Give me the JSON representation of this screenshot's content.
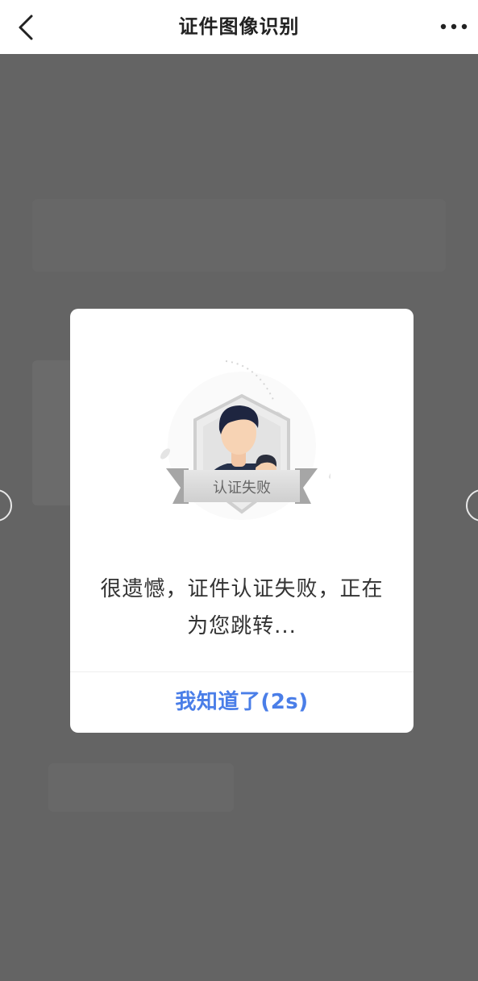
{
  "header": {
    "title": "证件图像识别"
  },
  "dialog": {
    "badge_text": "认证失败",
    "message": "很遗憾，证件认证失败，正在为您跳转...",
    "button_label": "我知道了(2s)"
  },
  "colors": {
    "accent": "#4a7ee8",
    "backdrop": "#646464"
  },
  "icons": {
    "back": "chevron-left-icon",
    "more": "more-dots-icon",
    "illustration": "verification-failed-illustration"
  }
}
